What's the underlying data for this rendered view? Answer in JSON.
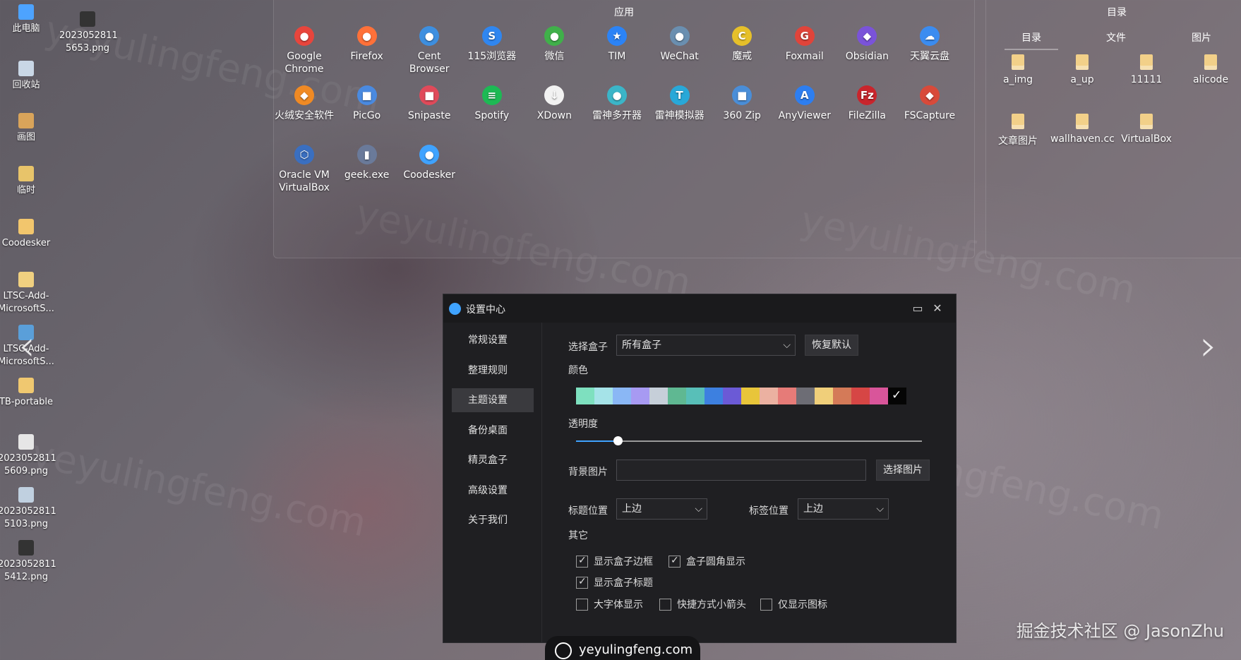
{
  "watermark_text": "yeyulingfeng.com",
  "desktop_icons": [
    {
      "label": "此电脑",
      "icon": "computer-icon",
      "color": "#4da3ff"
    },
    {
      "label": "2023052811\n5653.png",
      "icon": "image-file-icon",
      "color": "#333333"
    },
    {
      "label": "回收站",
      "icon": "recycle-bin-icon",
      "color": "#c9d7e6"
    },
    {
      "label": "画图",
      "icon": "paint-icon",
      "color": "#d9a45a"
    },
    {
      "label": "临时",
      "icon": "folder-icon",
      "color": "#e8c46a"
    },
    {
      "label": "Coodesker",
      "icon": "folder-icon",
      "color": "#f2c66d"
    },
    {
      "label": "LTSC-Add-\nMicrosoftS...",
      "icon": "folder-icon",
      "color": "#f0d080"
    },
    {
      "label": "LTSC-Add-\nMicrosoftS...",
      "icon": "folder-icon",
      "color": "#5a9fd9"
    },
    {
      "label": "TB-portable",
      "icon": "folder-icon",
      "color": "#f0c870"
    },
    {
      "label": "2023052811\n5609.png",
      "icon": "image-file-icon",
      "color": "#e6e6e6"
    },
    {
      "label": "2023052811\n5103.png",
      "icon": "image-file-icon",
      "color": "#c0d0e0"
    },
    {
      "label": "2023052811\n5412.png",
      "icon": "image-file-icon",
      "color": "#333333"
    }
  ],
  "apps_fence": {
    "title": "应用",
    "apps": [
      {
        "label": "Google\nChrome",
        "icon": "chrome-icon",
        "color": "#e8453c",
        "glyph": "●"
      },
      {
        "label": "Firefox",
        "icon": "firefox-icon",
        "color": "#ff7139",
        "glyph": "●"
      },
      {
        "label": "Cent\nBrowser",
        "icon": "cent-browser-icon",
        "color": "#3d8fe0",
        "glyph": "●"
      },
      {
        "label": "115浏览器",
        "icon": "115-browser-icon",
        "color": "#2f86f0",
        "glyph": "S"
      },
      {
        "label": "微信",
        "icon": "wechat-icon",
        "color": "#40b04a",
        "glyph": "●"
      },
      {
        "label": "TIM",
        "icon": "tim-icon",
        "color": "#2b83f6",
        "glyph": "★"
      },
      {
        "label": "WeChat",
        "icon": "wechat-work-icon",
        "color": "#6a8fb0",
        "glyph": "●"
      },
      {
        "label": "魔戒",
        "icon": "moje-icon",
        "color": "#e6c02a",
        "glyph": "C"
      },
      {
        "label": "Foxmail",
        "icon": "foxmail-icon",
        "color": "#e0443a",
        "glyph": "G"
      },
      {
        "label": "Obsidian",
        "icon": "obsidian-icon",
        "color": "#7a53d9",
        "glyph": "◆"
      },
      {
        "label": "天翼云盘",
        "icon": "tianyi-cloud-icon",
        "color": "#3b8cf0",
        "glyph": "☁"
      },
      {
        "label": "火绒安全软件",
        "icon": "huorong-icon",
        "color": "#f08a24",
        "glyph": "◆"
      },
      {
        "label": "PicGo",
        "icon": "picgo-icon",
        "color": "#4a8ae0",
        "glyph": "■"
      },
      {
        "label": "Snipaste",
        "icon": "snipaste-icon",
        "color": "#e04a5a",
        "glyph": "■"
      },
      {
        "label": "Spotify",
        "icon": "spotify-icon",
        "color": "#1db954",
        "glyph": "≡"
      },
      {
        "label": "XDown",
        "icon": "xdown-icon",
        "color": "#f2f2f2",
        "glyph": "↓"
      },
      {
        "label": "雷神多开器",
        "icon": "leishen-multi-icon",
        "color": "#3bb5c8",
        "glyph": "●"
      },
      {
        "label": "雷神模拟器",
        "icon": "leishen-emulator-icon",
        "color": "#28a8d8",
        "glyph": "T"
      },
      {
        "label": "360 Zip",
        "icon": "360zip-icon",
        "color": "#4a8ed8",
        "glyph": "■"
      },
      {
        "label": "AnyViewer",
        "icon": "anyviewer-icon",
        "color": "#2d7ef0",
        "glyph": "A"
      },
      {
        "label": "FileZilla",
        "icon": "filezilla-icon",
        "color": "#c9252c",
        "glyph": "Fz"
      },
      {
        "label": "FSCapture",
        "icon": "fscapture-icon",
        "color": "#d84a3a",
        "glyph": "◆"
      },
      {
        "label": "Oracle VM\nVirtualBox",
        "icon": "virtualbox-icon",
        "color": "#3a6fc0",
        "glyph": "⬡"
      },
      {
        "label": "geek.exe",
        "icon": "geek-icon",
        "color": "#6a7a9a",
        "glyph": "▮"
      },
      {
        "label": "Coodesker",
        "icon": "coodesker-icon",
        "color": "#3fa3ff",
        "glyph": "●"
      }
    ]
  },
  "dir_fence": {
    "title": "目录",
    "tabs": [
      "目录",
      "文件",
      "图片"
    ],
    "folders": [
      "a_img",
      "a_up",
      "11111",
      "alicode",
      "文章图片",
      "wallhaven.cc",
      "VirtualBox"
    ]
  },
  "dialog": {
    "title": "设置中心",
    "side_items": [
      "常规设置",
      "整理规则",
      "主题设置",
      "备份桌面",
      "精灵盒子",
      "高级设置",
      "关于我们"
    ],
    "active_index": 2,
    "select_box_label": "选择盒子",
    "select_box_value": "所有盒子",
    "restore_button": "恢复默认",
    "color_label": "颜色",
    "palette": [
      "#7ee0bf",
      "#a5e3e8",
      "#8ab7f5",
      "#a79af2",
      "#c6cfd9",
      "#5fb892",
      "#58bfb8",
      "#3d80e0",
      "#6b5ad6",
      "#e8c53a",
      "#ebb1a1",
      "#e67b78",
      "#6d6d75",
      "#f0cf7a",
      "#d47a58",
      "#d64645",
      "#d9559a",
      "#050505"
    ],
    "opacity_label": "透明度",
    "opacity_value": 0.12,
    "bg_image_label": "背景图片",
    "bg_image_value": "",
    "choose_image_button": "选择图片",
    "title_pos_label": "标题位置",
    "title_pos_value": "上边",
    "tag_pos_label": "标签位置",
    "tag_pos_value": "上边",
    "other_label": "其它",
    "checks": [
      {
        "label": "显示盒子边框",
        "checked": true
      },
      {
        "label": "盒子圆角显示",
        "checked": true
      },
      {
        "label": "显示盒子标题",
        "checked": true
      },
      {
        "label": "大字体显示",
        "checked": false
      },
      {
        "label": "快捷方式小箭头",
        "checked": false
      },
      {
        "label": "仅显示图标",
        "checked": false
      }
    ]
  },
  "credit": "掘金技术社区 @ JasonZhu",
  "site": "yeyulingfeng.com"
}
